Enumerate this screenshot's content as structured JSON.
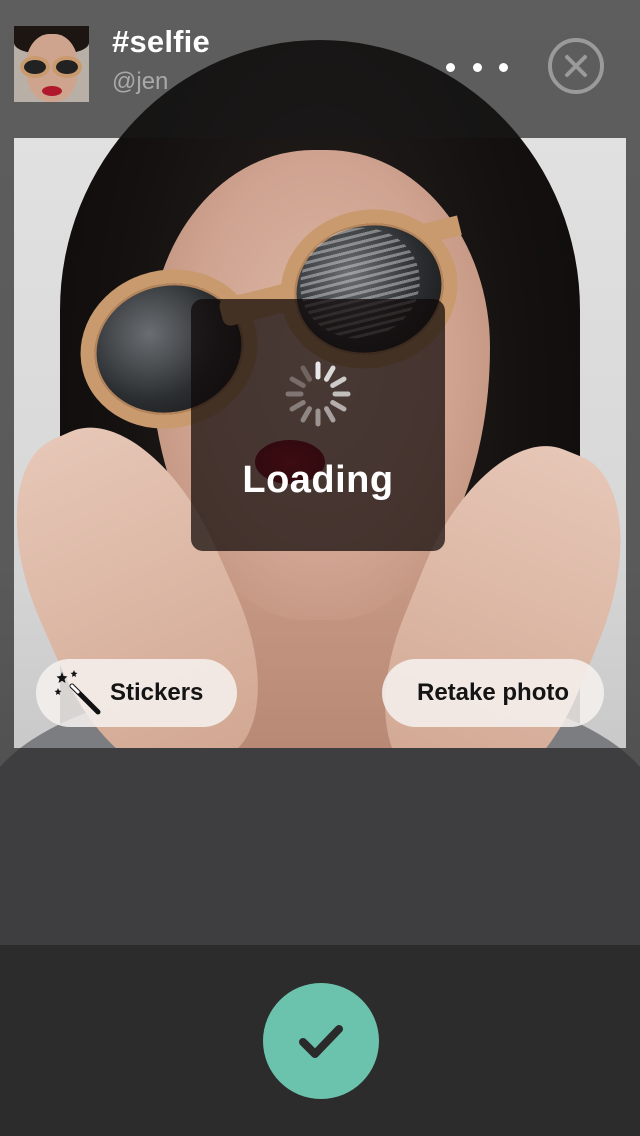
{
  "header": {
    "title": "#selfie",
    "username": "@jen",
    "more_icon": "ellipsis-icon",
    "close_icon": "close-circle-icon"
  },
  "loading": {
    "label": "Loading",
    "spinner_icon": "spinner-icon"
  },
  "photo_actions": {
    "stickers_label": "Stickers",
    "stickers_icon": "magic-wand-icon",
    "retake_label": "Retake photo"
  },
  "bottom_bar": {
    "confirm_icon": "checkmark-icon",
    "confirm_color": "#6cc3ad"
  },
  "colors": {
    "background": "#2c2c2c",
    "accent": "#6cc3ad",
    "title_text": "#ffffff",
    "subtitle_text": "#a9a9a9"
  }
}
